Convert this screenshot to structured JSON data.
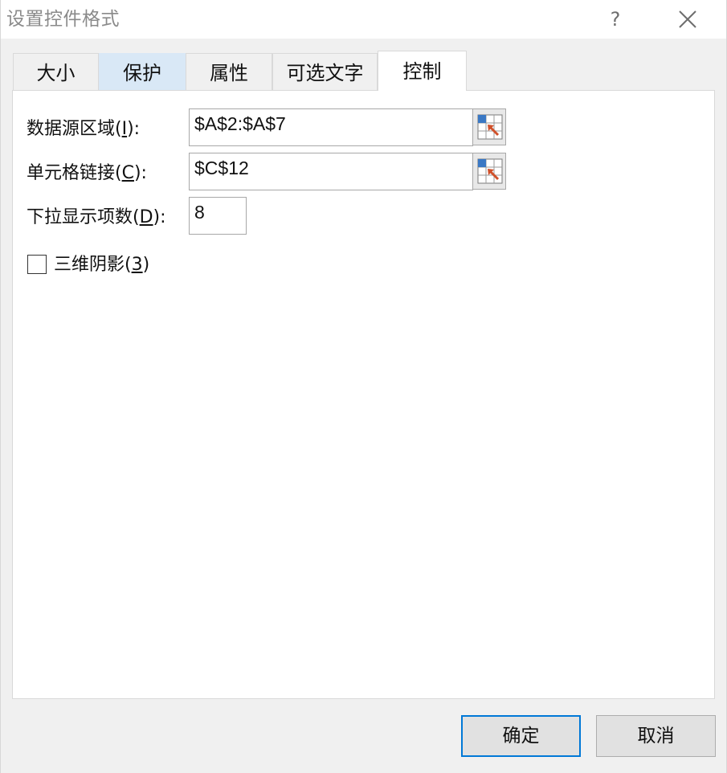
{
  "dialog": {
    "title": "设置控件格式",
    "help_label": "?",
    "close_icon": "close-icon"
  },
  "tabs": [
    {
      "label": "大小",
      "state": "normal"
    },
    {
      "label": "保护",
      "state": "hover"
    },
    {
      "label": "属性",
      "state": "normal"
    },
    {
      "label": "可选文字",
      "state": "normal"
    },
    {
      "label": "控制",
      "state": "active"
    }
  ],
  "control": {
    "source_range": {
      "label_prefix": "数据源区域(",
      "label_key": "I",
      "label_suffix": "):",
      "value": "$A$2:$A$7",
      "icon": "range-select-icon"
    },
    "cell_link": {
      "label_prefix": "单元格链接(",
      "label_key": "C",
      "label_suffix": "):",
      "value": "$C$12",
      "icon": "range-select-icon"
    },
    "dropdown_lines": {
      "label_prefix": "下拉显示项数(",
      "label_key": "D",
      "label_suffix": "):",
      "value": "8"
    },
    "shading_3d": {
      "label_prefix": "三维阴影(",
      "label_key": "3",
      "label_suffix": ")",
      "checked": false
    }
  },
  "footer": {
    "ok_label": "确定",
    "cancel_label": "取消"
  },
  "colors": {
    "accent": "#0078d7",
    "hover_tab": "#d9e8f6",
    "ref_icon_blue": "#3a78c4",
    "ref_icon_arrow": "#d0502a"
  }
}
